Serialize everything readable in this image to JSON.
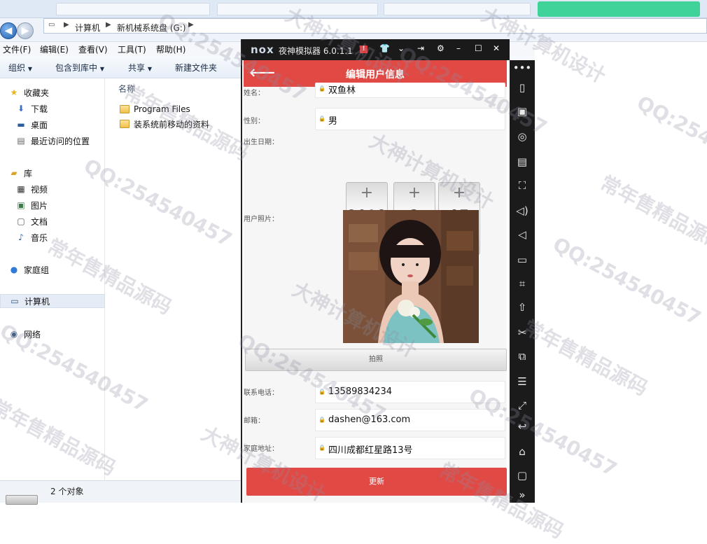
{
  "explorer": {
    "path": [
      "计算机",
      "新机械系统盘 (G:)"
    ],
    "menu": [
      "文件(F)",
      "编辑(E)",
      "查看(V)",
      "工具(T)",
      "帮助(H)"
    ],
    "toolbar": [
      "组织",
      "包含到库中",
      "共享",
      "新建文件夹"
    ],
    "sidebar": [
      {
        "label": "收藏夹",
        "icon": "star-icon"
      },
      {
        "label": "下载",
        "icon": "download-icon"
      },
      {
        "label": "桌面",
        "icon": "desktop-icon"
      },
      {
        "label": "最近访问的位置",
        "icon": "recent-places-icon"
      },
      {
        "label": "库",
        "icon": "library-icon"
      },
      {
        "label": "视频",
        "icon": "video-icon"
      },
      {
        "label": "图片",
        "icon": "picture-icon"
      },
      {
        "label": "文档",
        "icon": "document-icon"
      },
      {
        "label": "音乐",
        "icon": "music-icon"
      },
      {
        "label": "家庭组",
        "icon": "homegroup-icon"
      },
      {
        "label": "计算机",
        "icon": "computer-icon"
      },
      {
        "label": "网络",
        "icon": "network-icon"
      }
    ],
    "column_header": "名称",
    "files": [
      "Program Files",
      "装系统前移动的资料"
    ],
    "status": "2 个对象"
  },
  "emulator": {
    "logo": "nox",
    "name": "夜神模拟器 6.0.1.1",
    "app_title": "编辑用户信息",
    "fields": {
      "name_label": "姓名：",
      "name_value": "双鱼林",
      "gender_label": "性别：",
      "gender_value": "男",
      "birthday_label": "出生日期：",
      "year": "2018",
      "month": "3",
      "day": "07",
      "photo_label": "用户照片：",
      "photo_button": "拍照",
      "phone_label": "联系电话：",
      "phone_value": "13589834234",
      "email_label": "邮箱：",
      "email_value": "dashen@163.com",
      "address_label": "家庭地址：",
      "address_value": "四川成都红星路13号"
    },
    "update_button": "更新"
  },
  "watermarks": [
    "QQ:254540457",
    "常年售精品源码",
    "大神计算机设计"
  ]
}
